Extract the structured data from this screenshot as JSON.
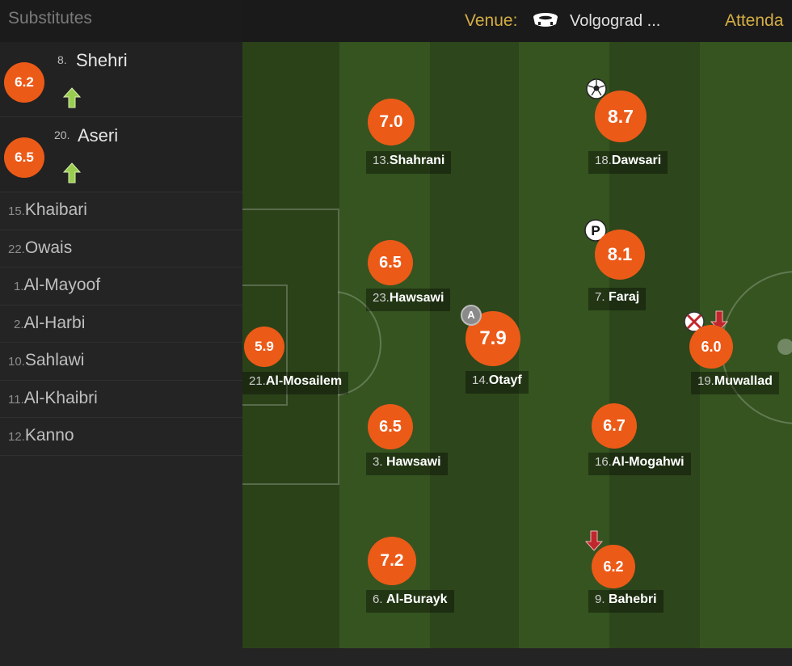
{
  "sidebar": {
    "title": "Substitutes",
    "rated_subs": [
      {
        "rating": "6.2",
        "number": "8.",
        "name": "Shehri"
      },
      {
        "rating": "6.5",
        "number": "20.",
        "name": "Aseri"
      }
    ],
    "subs": [
      {
        "number": "15.",
        "name": "Khaibari"
      },
      {
        "number": "22.",
        "name": "Owais"
      },
      {
        "number": "1.",
        "name": "Al-Mayoof"
      },
      {
        "number": "2.",
        "name": "Al-Harbi"
      },
      {
        "number": "10.",
        "name": "Sahlawi"
      },
      {
        "number": "11.",
        "name": "Al-Khaibri"
      },
      {
        "number": "12.",
        "name": "Kanno"
      }
    ]
  },
  "header": {
    "venue_label": "Venue:",
    "venue_value": "Volgograd ...",
    "venue_icon": "stadium-icon",
    "attendance_label": "Attenda"
  },
  "pitch": {
    "players": [
      {
        "rating": "5.9",
        "number": "21.",
        "name": "Al-Mosailem"
      },
      {
        "rating": "7.0",
        "number": "13.",
        "name": "Shahrani"
      },
      {
        "rating": "6.5",
        "number": "23.",
        "name": "Hawsawi"
      },
      {
        "rating": "6.5",
        "number": "3.",
        "name": "Hawsawi"
      },
      {
        "rating": "7.2",
        "number": "6.",
        "name": "Al-Burayk"
      },
      {
        "rating": "7.9",
        "number": "14.",
        "name": "Otayf",
        "captain": "A"
      },
      {
        "rating": "8.7",
        "number": "18.",
        "name": "Dawsari",
        "badge": "goal-icon"
      },
      {
        "rating": "8.1",
        "number": "7.",
        "name": "Faraj",
        "badge": "penalty-icon"
      },
      {
        "rating": "6.7",
        "number": "16.",
        "name": "Al-Mogahwi"
      },
      {
        "rating": "6.2",
        "number": "9.",
        "name": "Bahebri",
        "badge": "sub-off-icon"
      },
      {
        "rating": "6.0",
        "number": "19.",
        "name": "Muwallad",
        "badge": "missed-chance-icon"
      }
    ]
  },
  "colors": {
    "rating_bg": "#ec5a18",
    "venue_label": "#d4ad44",
    "sub_on_arrow": "#9acd4f",
    "sub_off_arrow": "#c0272d"
  }
}
